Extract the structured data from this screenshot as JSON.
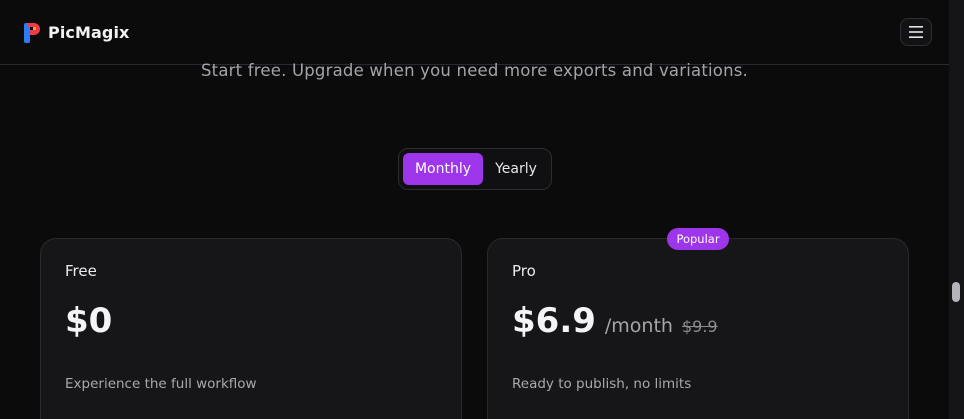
{
  "brand": {
    "name": "PicMagix",
    "logo_icon": "picmagix-logo-icon",
    "logo_colors": {
      "left": "#2b7cf6",
      "right": "#f03a4c",
      "accent": "#f7a21b"
    }
  },
  "header": {
    "menu_icon": "hamburger-menu-icon"
  },
  "hero": {
    "subtitle": "Start free. Upgrade when you need more exports and variations."
  },
  "billing_toggle": {
    "options": [
      {
        "label": "Monthly",
        "selected": true
      },
      {
        "label": "Yearly",
        "selected": false
      }
    ]
  },
  "plans": [
    {
      "name": "Free",
      "price": "$0",
      "description": "Experience the full workflow"
    },
    {
      "name": "Pro",
      "badge": "Popular",
      "price": "$6.9",
      "period": "/month",
      "old_price": "$9.9",
      "description": "Ready to publish, no limits"
    }
  ],
  "colors": {
    "accent": "#9d35ea",
    "background": "#0b0b0c",
    "card": "#161618"
  }
}
